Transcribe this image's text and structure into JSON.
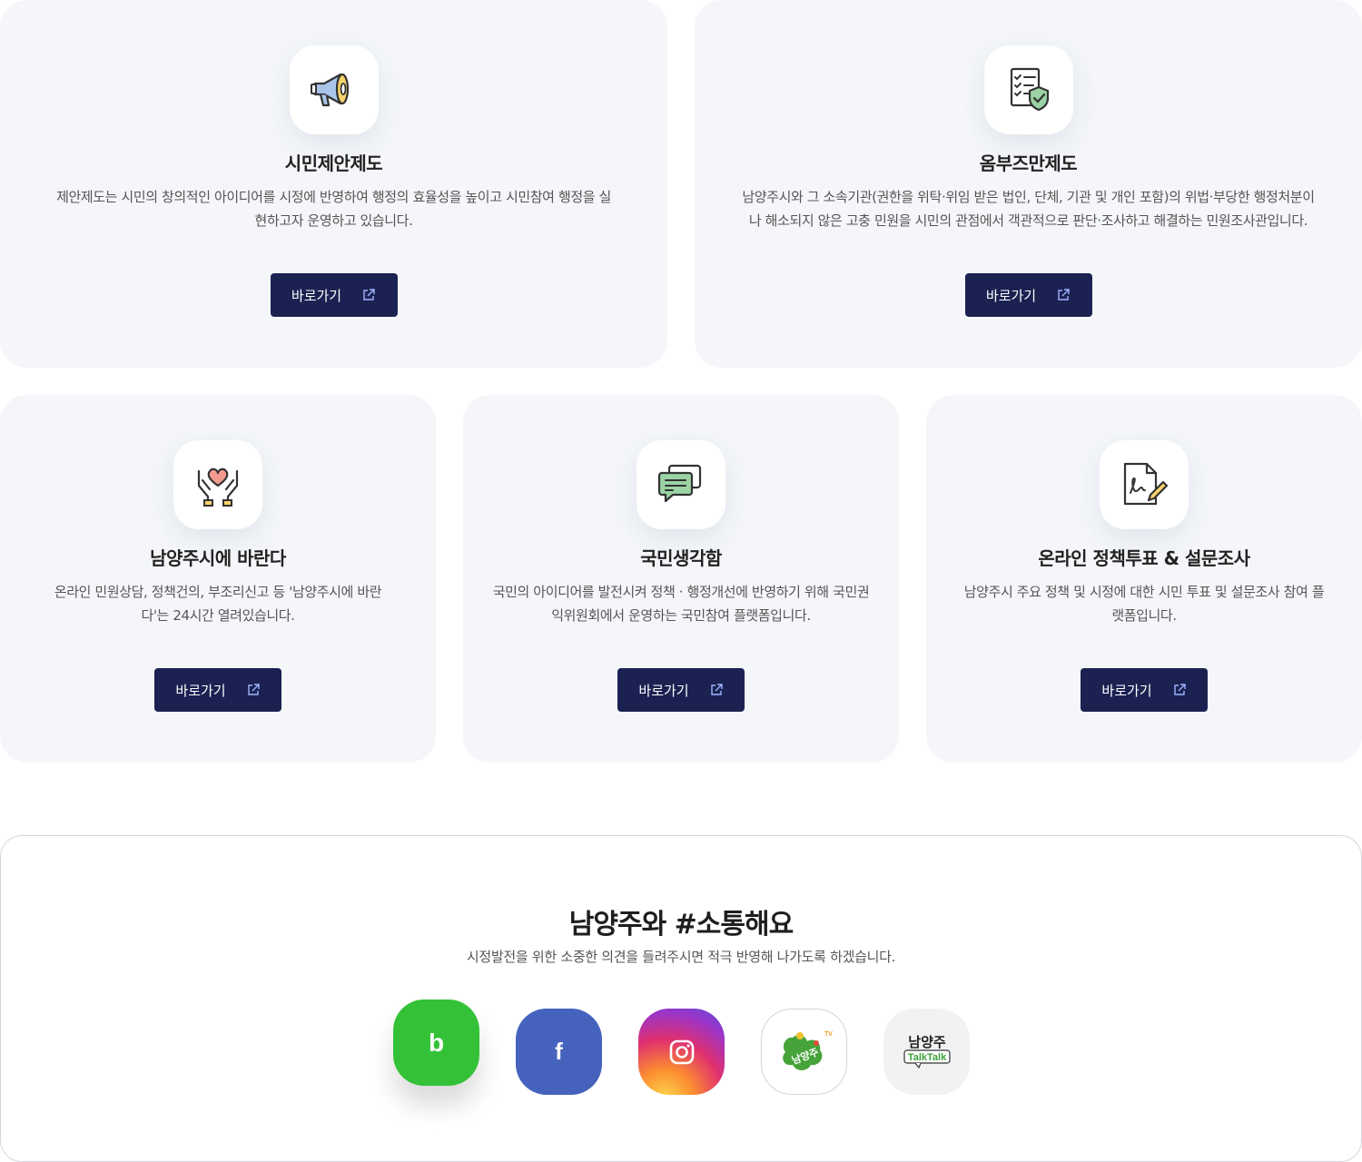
{
  "cards": [
    {
      "title": "시민제안제도",
      "desc": "제안제도는 시민의 창의적인 아이디어를 시정에 반영하여 행정의 효율성을 높이고 시민참여 행정을 실현하고자 운영하고 있습니다.",
      "button": "바로가기",
      "icon": "megaphone-icon"
    },
    {
      "title": "옴부즈만제도",
      "desc": "남양주시와 그 소속기관(권한을 위탁·위임 받은 법인, 단체, 기관 및 개인 포함)의 위법·부당한 행정처분이나 해소되지 않은 고충 민원을 시민의 관점에서 객관적으로 판단·조사하고 해결하는 민원조사관입니다.",
      "button": "바로가기",
      "icon": "checklist-shield-icon"
    },
    {
      "title": "남양주시에 바란다",
      "desc": "온라인 민원상담, 정책건의, 부조리신고 등 '남양주시에 바란다'는 24시간 열려있습니다.",
      "button": "바로가기",
      "icon": "heart-hands-icon"
    },
    {
      "title": "국민생각함",
      "desc": "국민의 아이디어를 발전시켜 정책 · 행정개선에 반영하기 위해 국민권익위원회에서 운영하는 국민참여 플랫폼입니다.",
      "button": "바로가기",
      "icon": "chat-bubbles-icon"
    },
    {
      "title": "온라인 정책투표 & 설문조사",
      "desc": "남양주시 주요 정책 및 시정에 대한 시민 투표 및 설문조사 참여 플랫폼입니다.",
      "button": "바로가기",
      "icon": "document-sign-icon"
    }
  ],
  "communication": {
    "title": "남양주와 #소통해요",
    "desc": "시정발전을 위한 소중한 의견을 들려주시면 적극 반영해 나가도록 하겠습니다.",
    "sns": [
      {
        "name": "blog",
        "letter": "b",
        "color": "#33c237"
      },
      {
        "name": "facebook",
        "letter": "f",
        "color": "#4563bd"
      },
      {
        "name": "instagram",
        "color": "#e0306f"
      },
      {
        "name": "namyangju-tv",
        "text": "남양주",
        "badge": "TV"
      },
      {
        "name": "namyangju-talktalk",
        "text": "남양주",
        "sub": "TalkTalk"
      }
    ]
  }
}
